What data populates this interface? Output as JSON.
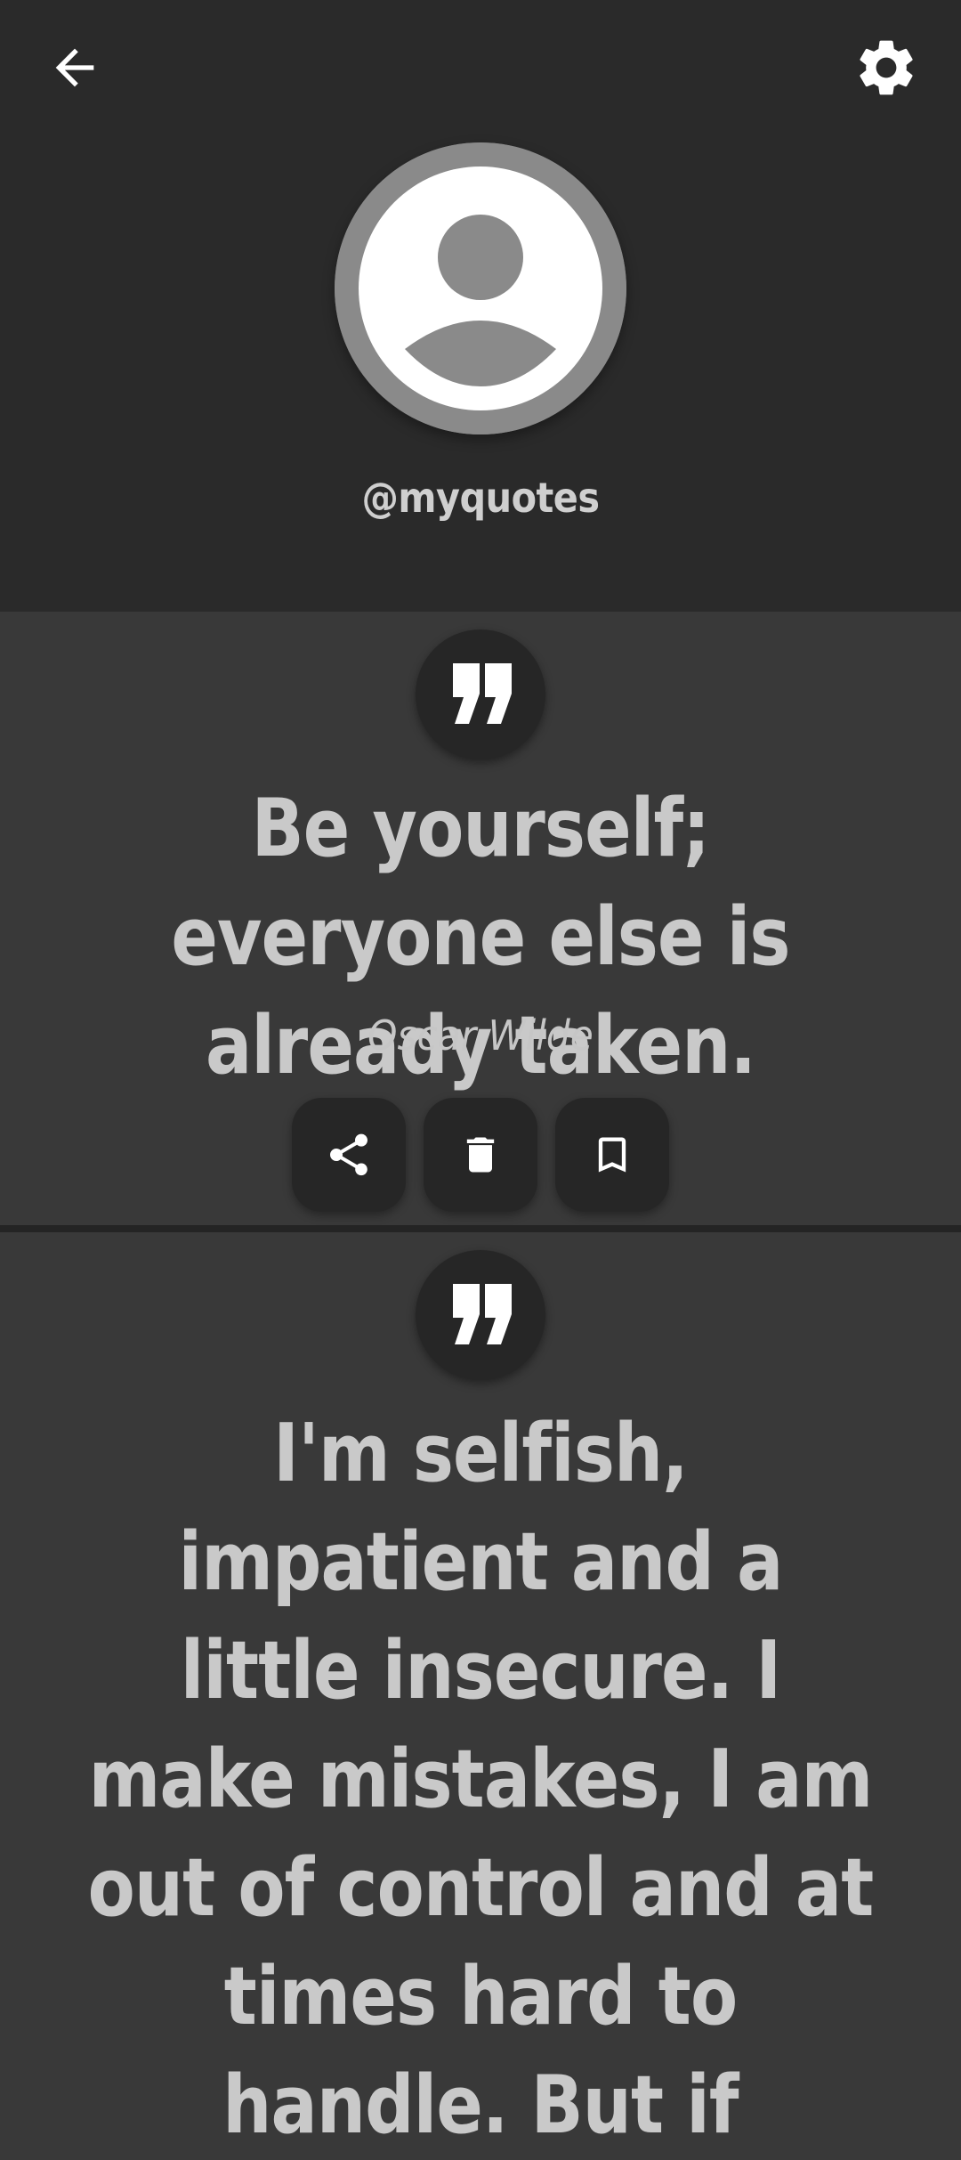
{
  "header": {
    "back_icon": "arrow-back-icon",
    "settings_icon": "gear-icon",
    "avatar_icon": "account-circle-icon",
    "username": "@myquotes"
  },
  "quotes": [
    {
      "text": "Be yourself; everyone else is already taken.",
      "author": "Oscar Wilde",
      "actions": [
        "share-icon",
        "trash-icon",
        "bookmark-icon"
      ]
    },
    {
      "text": "I'm selfish, impatient and a little insecure. I make mistakes, I am out of control and at times hard to handle. But if"
    }
  ],
  "colors": {
    "header_bg": "#2a2a2a",
    "card_bg": "#393939",
    "button_bg": "#262626",
    "text": "#c9c9c9"
  }
}
